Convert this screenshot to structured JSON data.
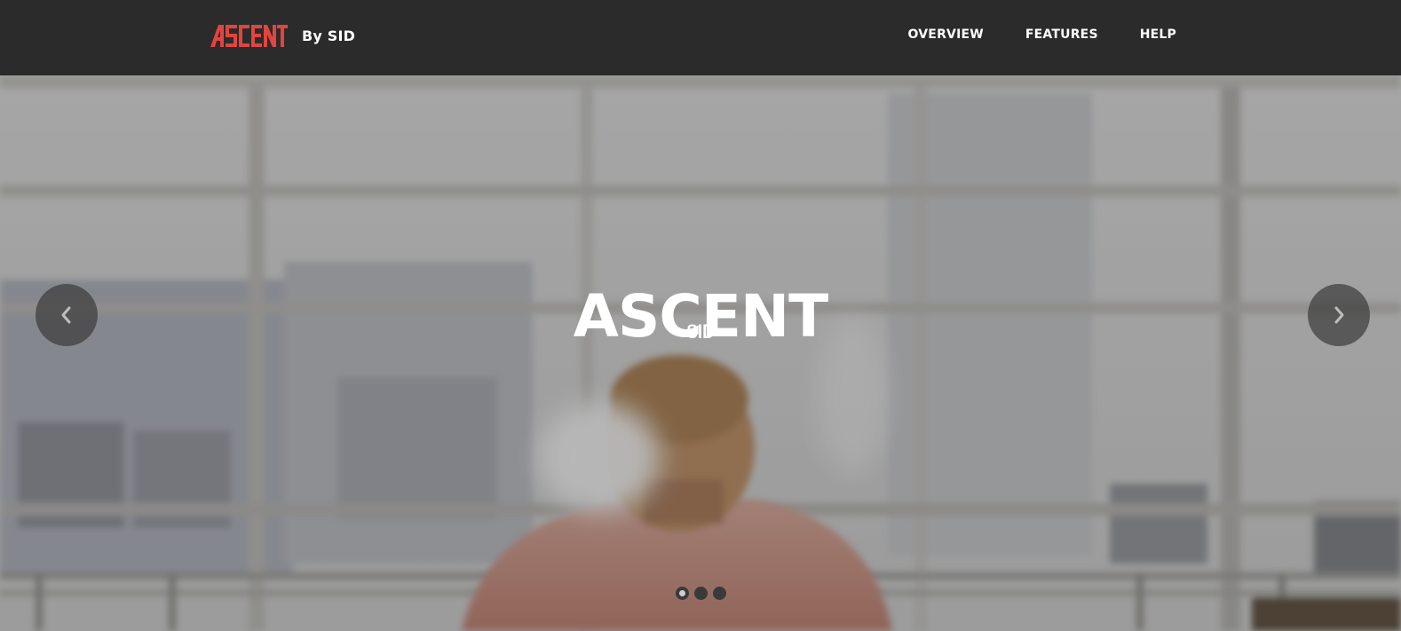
{
  "brand": {
    "logo_text": "ASCENT",
    "byline": "By SID",
    "accent_color": "#e0453f"
  },
  "nav": {
    "items": [
      {
        "label": "OVERVIEW"
      },
      {
        "label": "FEATURES"
      },
      {
        "label": "HELP"
      }
    ]
  },
  "hero": {
    "title": "ASCENT",
    "subtitle": "SID",
    "prev_icon": "chevron-left-icon",
    "next_icon": "chevron-right-icon",
    "slides_total": 3,
    "active_slide": 1
  }
}
